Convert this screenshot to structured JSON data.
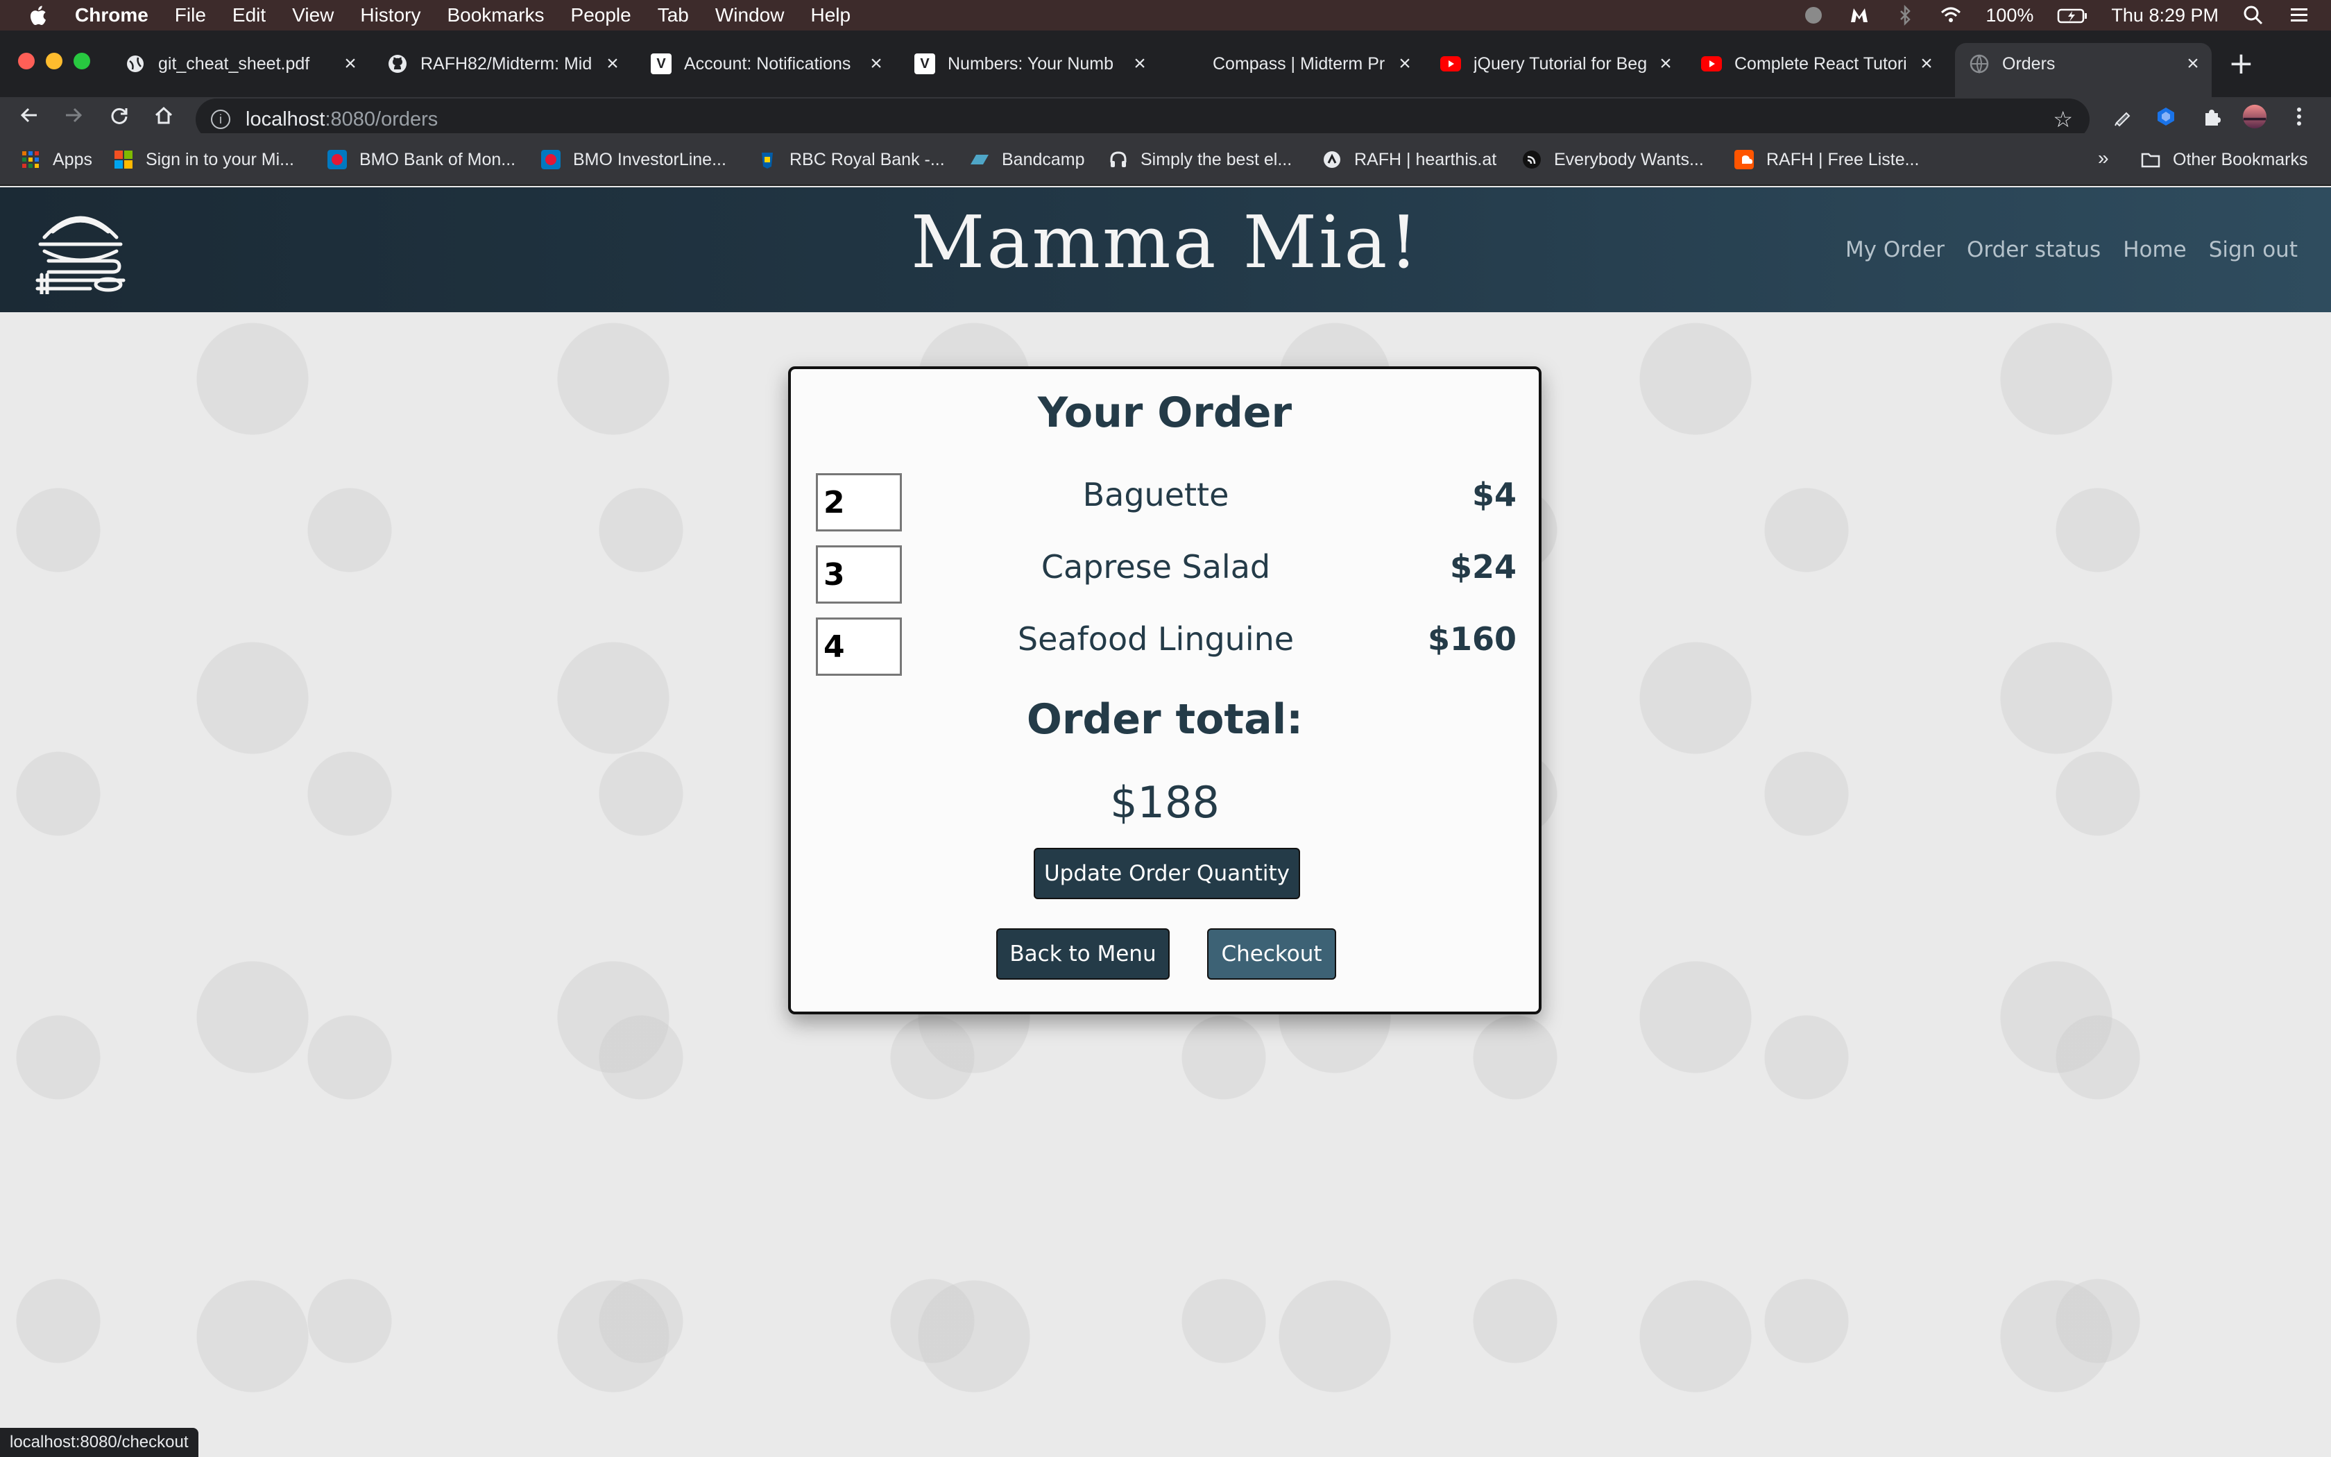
{
  "os_menubar": {
    "app_name": "Chrome",
    "menus": [
      "File",
      "Edit",
      "View",
      "History",
      "Bookmarks",
      "People",
      "Tab",
      "Window",
      "Help"
    ],
    "battery": "100%",
    "clock": "Thu 8:29 PM"
  },
  "browser": {
    "tabs": [
      {
        "title": "git_cheat_sheet.pdf",
        "icon": "globe-icon"
      },
      {
        "title": "RAFH82/Midterm: Mid",
        "icon": "github-icon"
      },
      {
        "title": "Account: Notifications",
        "icon": "v-icon"
      },
      {
        "title": "Numbers: Your Numb",
        "icon": "v-icon"
      },
      {
        "title": "Compass | Midterm Pr",
        "icon": "compass-icon"
      },
      {
        "title": "jQuery Tutorial for Beg",
        "icon": "youtube-icon"
      },
      {
        "title": "Complete React Tutori",
        "icon": "youtube-icon"
      },
      {
        "title": "Orders",
        "icon": "globe-icon",
        "active": true
      }
    ],
    "url": {
      "host": "localhost",
      "path": ":8080/orders"
    },
    "bookmarks": [
      {
        "label": "Apps",
        "icon": "apps-grid-icon"
      },
      {
        "label": "Sign in to your Mi...",
        "icon": "microsoft-icon"
      },
      {
        "label": "BMO Bank of Mon...",
        "icon": "bmo-icon"
      },
      {
        "label": "BMO InvestorLine...",
        "icon": "bmo-icon"
      },
      {
        "label": "RBC Royal Bank -...",
        "icon": "rbc-icon"
      },
      {
        "label": "Bandcamp",
        "icon": "bandcamp-icon"
      },
      {
        "label": "Simply the best el...",
        "icon": "headphones-icon"
      },
      {
        "label": "RAFH | hearthis.at",
        "icon": "hearthis-icon"
      },
      {
        "label": "Everybody Wants...",
        "icon": "rss-icon"
      },
      {
        "label": "RAFH | Free Liste...",
        "icon": "soundcloud-icon"
      }
    ],
    "other_bookmarks": "Other Bookmarks",
    "status_url": "localhost:8080/checkout"
  },
  "site": {
    "title": "Mamma Mia!",
    "nav": [
      "My Order",
      "Order status",
      "Home",
      "Sign out"
    ]
  },
  "order": {
    "heading": "Your Order",
    "items": [
      {
        "qty": "2",
        "name": "Baguette",
        "price": "$4"
      },
      {
        "qty": "3",
        "name": "Caprese Salad",
        "price": "$24"
      },
      {
        "qty": "4",
        "name": "Seafood Linguine",
        "price": "$160"
      }
    ],
    "total_label": "Order total:",
    "total_value": "$188",
    "update_button": "Update Order Quantity",
    "back_button": "Back to Menu",
    "checkout_button": "Checkout"
  },
  "colors": {
    "header_dark": "#1b2a35",
    "header_light": "#2f4c5e",
    "text_primary": "#243b48",
    "button_dark": "#243b48",
    "button_checkout": "#3d6275"
  }
}
